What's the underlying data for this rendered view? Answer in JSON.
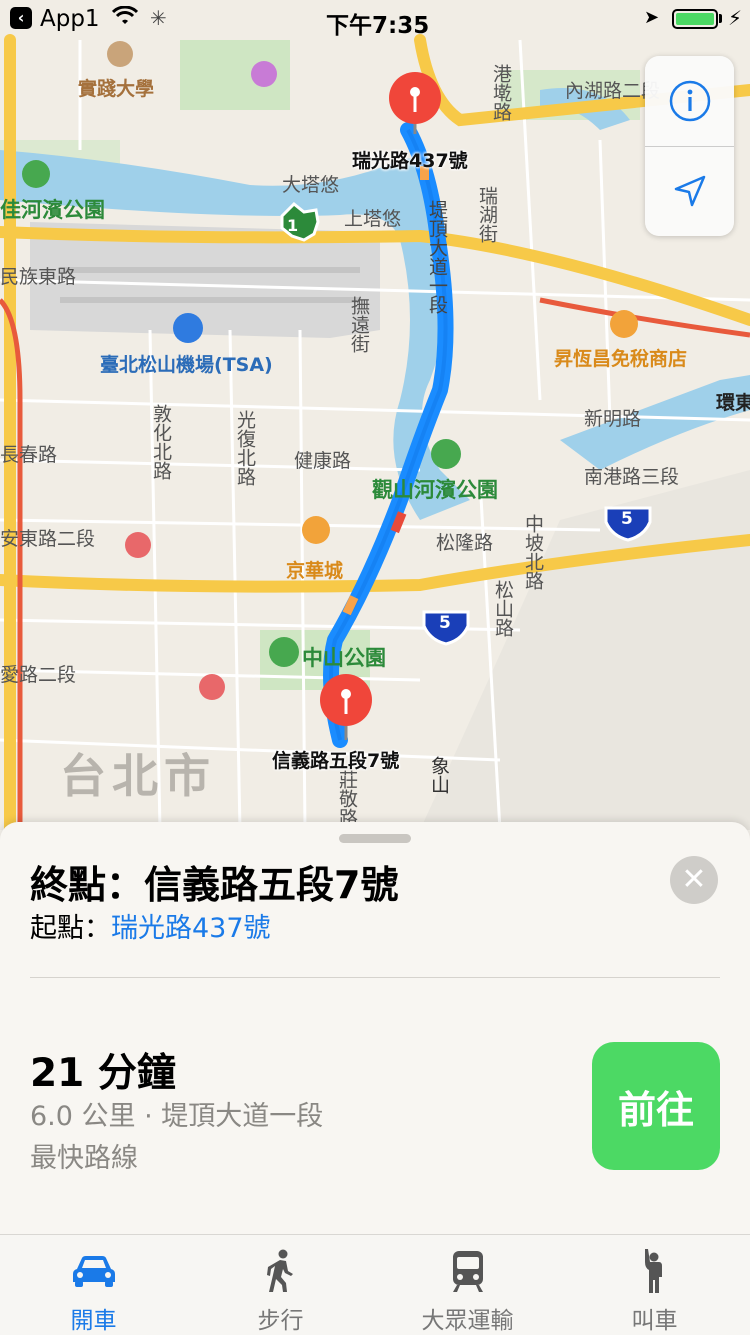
{
  "status_bar": {
    "back_app": "App1",
    "time": "下午7:35",
    "battery_level": 1.0
  },
  "map": {
    "city_label": "台北市",
    "labels": {
      "shijian_univ": "實踐大學",
      "neihu_rd": "內湖路二段",
      "dataxiu": "大塔悠",
      "shangtaxiu": "上塔悠",
      "riverside_park": "佳河濱公園",
      "minzu_e_rd": "民族東路",
      "airport": "臺北松山機場",
      "airport_code": "(TSA)",
      "changchun_rd": "長春路",
      "anhe_rd": "安東路二段",
      "aiguo_rd": "愛路二段",
      "jiankang_rd": "健康路",
      "guanshan_park": "觀山河濱公園",
      "jinghua_city": "京華城",
      "songlong_rd": "松隆路",
      "zhongshan_park": "中山公園",
      "nangang_rd": "南港路三段",
      "xinming_rd": "新明路",
      "duty_free": "昇恆昌免稅商店",
      "huandong": "環東",
      "dunhua_n": "敦化北路",
      "guangfu_n": "光復北路",
      "tidingdadao": "堤頂大道一段",
      "ruihu_st": "瑞湖街",
      "gangqian": "港墘路",
      "jitong": "撫遠街",
      "zhongpo_n": "中坡北路",
      "songshan_rd": "松山路",
      "xiangshan": "象山",
      "zhuangjing_rd": "莊敬路",
      "highway_1": "1",
      "highway_5a": "5",
      "highway_5b": "5"
    },
    "start_pin_label": "瑞光路437號",
    "end_pin_label": "信義路五段7號"
  },
  "map_controls": {
    "info_icon": "info-icon",
    "location_icon": "location-arrow-icon"
  },
  "sheet": {
    "destination": "終點：信義路五段7號",
    "origin_label": "起點：",
    "origin_value": "瑞光路437號",
    "duration": "21 分鐘",
    "detail": "6.0 公里 · 堤頂大道一段",
    "route_type": "最快路線",
    "go_label": "前往"
  },
  "tabs": [
    {
      "label": "開車",
      "icon": "car-icon",
      "active": true
    },
    {
      "label": "步行",
      "icon": "walk-icon",
      "active": false
    },
    {
      "label": "大眾運輸",
      "icon": "bus-icon",
      "active": false
    },
    {
      "label": "叫車",
      "icon": "hail-icon",
      "active": false
    }
  ],
  "colors": {
    "route": "#1a8cff",
    "accent": "#1a7ae8",
    "go_button": "#4cd964",
    "pin": "#f0463a",
    "highway": "#f7c948"
  }
}
